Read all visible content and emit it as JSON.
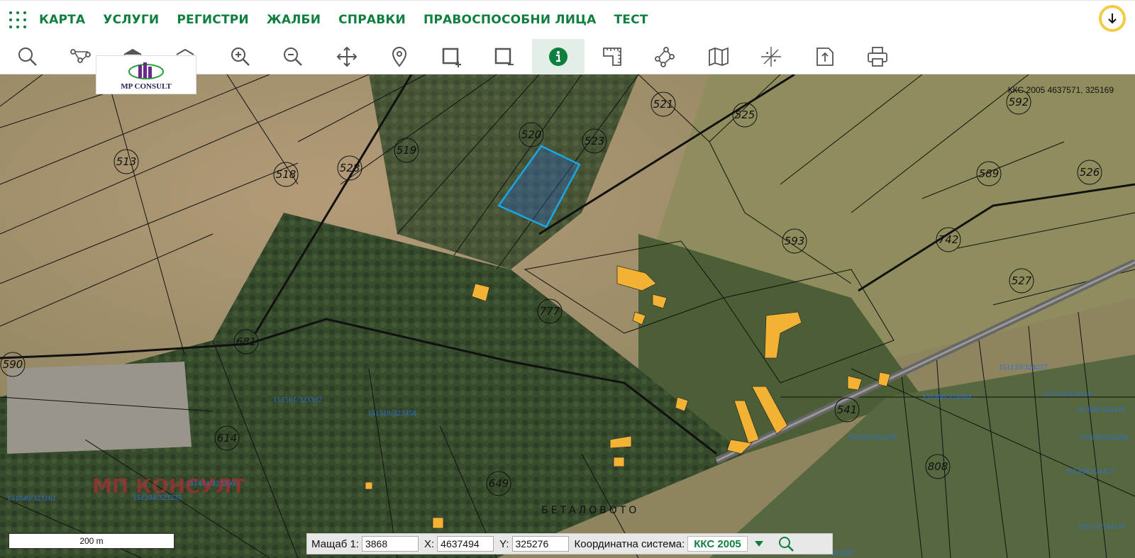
{
  "menu": {
    "items": [
      "КАРТА",
      "УСЛУГИ",
      "РЕГИСТРИ",
      "ЖАЛБИ",
      "СПРАВКИ",
      "ПРАВОСПОСОБНИ ЛИЦА",
      "ТЕСТ"
    ]
  },
  "toolbar": {
    "tools": [
      "search-icon",
      "route-icon",
      "layer-up-icon",
      "layer-down-icon",
      "zoom-in-icon",
      "zoom-out-icon",
      "pan-icon",
      "pin-icon",
      "select-add-icon",
      "select-remove-icon",
      "info-icon",
      "measure-icon",
      "polyline-icon",
      "map-icon",
      "crosshair-icon",
      "export-icon",
      "print-icon"
    ],
    "active": "info-icon"
  },
  "logo": {
    "text": "MP CONSULT"
  },
  "map": {
    "coord_readout": "ККС 2005 4637571, 325169",
    "parcels": [
      "513",
      "518",
      "528",
      "519",
      "520",
      "523",
      "521",
      "525",
      "592",
      "589",
      "526",
      "593",
      "742",
      "527",
      "777",
      "681",
      "590",
      "614",
      "649",
      "808",
      "541"
    ],
    "coords": [
      "151561/323302",
      "151518/323358",
      "151474/323260",
      "151204/323233",
      "151049/323161",
      "151133/324237",
      "151466/324004",
      "151710/324116",
      "151649/324135",
      "151639/324284",
      "151519/324178",
      "151328/324127",
      "151113/324178",
      "151001/324305"
    ],
    "watermark": "МП КОНСУЛТ",
    "place_name": "БЕТАЛОВОТО",
    "highlight_color": "#1aa7e6"
  },
  "scale": {
    "text": "200 m"
  },
  "status": {
    "scale_label": "Мащаб 1:",
    "scale_value": "3868",
    "x_label": "X:",
    "x_value": "4637494",
    "y_label": "Y:",
    "y_value": "325276",
    "system_label": "Координатна система:",
    "system_value": "ККС 2005"
  },
  "colors": {
    "brand": "#0f7f3f",
    "accent": "#f3cc44"
  }
}
